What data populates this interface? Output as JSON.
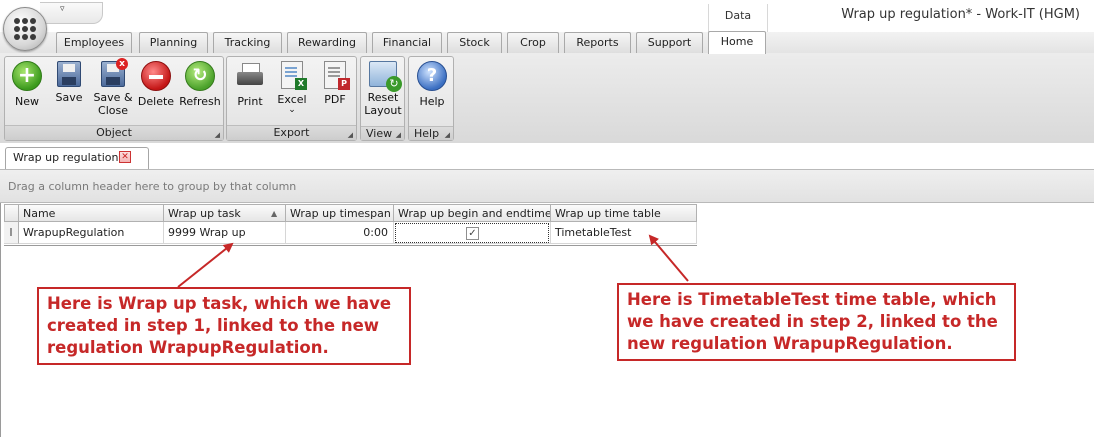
{
  "window": {
    "title": "Wrap up regulation* - Work-IT (HGM)",
    "context_tab_group": "Data"
  },
  "ribbon_tabs": [
    {
      "label": "Employees"
    },
    {
      "label": "Planning"
    },
    {
      "label": "Tracking"
    },
    {
      "label": "Rewarding"
    },
    {
      "label": "Financial"
    },
    {
      "label": "Stock"
    },
    {
      "label": "Crop"
    },
    {
      "label": "Reports"
    },
    {
      "label": "Support"
    },
    {
      "label": "Home",
      "active": true
    }
  ],
  "ribbon_groups": {
    "object": {
      "label": "Object",
      "buttons": {
        "new": {
          "label": "New",
          "icon": "plus-circle-icon"
        },
        "save": {
          "label": "Save",
          "icon": "floppy-disk-icon"
        },
        "save_close": {
          "label_line1": "Save &",
          "label_line2": "Close",
          "icon": "floppy-disk-close-icon"
        },
        "delete": {
          "label": "Delete",
          "icon": "minus-circle-icon"
        },
        "refresh": {
          "label": "Refresh",
          "icon": "refresh-icon"
        }
      }
    },
    "export": {
      "label": "Export",
      "buttons": {
        "print": {
          "label": "Print",
          "icon": "printer-icon"
        },
        "excel": {
          "label": "Excel",
          "dropdown_glyph": "⌄",
          "icon": "excel-document-icon"
        },
        "pdf": {
          "label": "PDF",
          "icon": "pdf-document-icon"
        }
      }
    },
    "view": {
      "label": "View",
      "buttons": {
        "reset_layout": {
          "label_line1": "Reset",
          "label_line2": "Layout",
          "icon": "reset-layout-icon"
        }
      }
    },
    "help": {
      "label": "Help",
      "buttons": {
        "help": {
          "label": "Help",
          "icon": "question-mark-icon"
        }
      }
    }
  },
  "document_tab": {
    "label": "Wrap up regulation*",
    "close_glyph": "✕"
  },
  "grid": {
    "group_panel_hint": "Drag a column header here to group by that column",
    "sort_glyph": "▲",
    "columns": [
      "Name",
      "Wrap up task",
      "Wrap up timespan",
      "Wrap up begin and endtime?",
      "Wrap up time table"
    ],
    "rows": [
      {
        "row_indicator": "I",
        "name": "WrapupRegulation",
        "task": "9999 Wrap up",
        "timespan": "0:00",
        "begin_end_checked": true,
        "check_glyph": "✓",
        "time_table": "TimetableTest"
      }
    ]
  },
  "annotations": {
    "left": {
      "line1": "Here is Wrap up task, which we have",
      "line2": "created in step 1, linked to the new",
      "line3": "regulation WrapupRegulation."
    },
    "right": {
      "line1": "Here is TimetableTest time table, which",
      "line2": "we have created in step 2, linked to the",
      "line3": "new regulation WrapupRegulation."
    },
    "color": "#c62828"
  }
}
